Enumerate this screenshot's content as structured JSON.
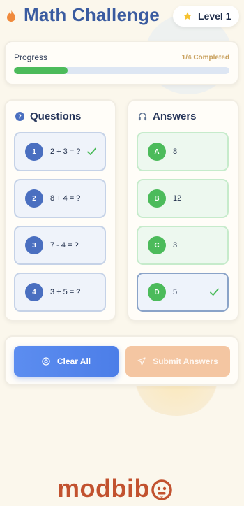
{
  "header": {
    "title": "Math Challenge",
    "level": "Level 1"
  },
  "progress": {
    "label": "Progress",
    "count": "1/4 Completed",
    "fraction": 0.25
  },
  "questions": {
    "heading": "Questions",
    "items": [
      {
        "num": "1",
        "text": "2 + 3 = ?",
        "answered": true
      },
      {
        "num": "2",
        "text": "8 + 4 = ?",
        "answered": false
      },
      {
        "num": "3",
        "text": "7 - 4 = ?",
        "answered": false
      },
      {
        "num": "4",
        "text": "3 + 5 = ?",
        "answered": false
      }
    ]
  },
  "answers": {
    "heading": "Answers",
    "items": [
      {
        "letter": "A",
        "text": "8",
        "used": false
      },
      {
        "letter": "B",
        "text": "12",
        "used": false
      },
      {
        "letter": "C",
        "text": "3",
        "used": false
      },
      {
        "letter": "D",
        "text": "5",
        "used": true
      }
    ]
  },
  "actions": {
    "clear": "Clear All",
    "submit": "Submit Answers"
  },
  "brand": {
    "logo_text": "modbib",
    "logo_text_tail": "o"
  },
  "colors": {
    "title": "#3a5ba0",
    "accent_blue": "#4a6fc0",
    "accent_green": "#4cbb5b",
    "progress_text": "#c9a15e",
    "submit_disabled": "#f4c6a2",
    "logo": "#c2522f"
  },
  "icons": {
    "header": "flame-icon",
    "level": "star-icon",
    "questions": "question-icon",
    "answers": "headphones-icon",
    "check": "check-icon",
    "clear": "reset-icon",
    "submit": "send-icon"
  }
}
